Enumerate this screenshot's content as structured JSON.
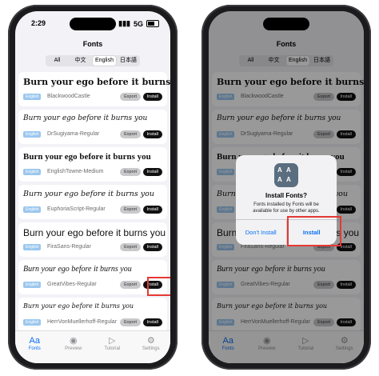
{
  "status": {
    "time": "2:29",
    "signal": "5G",
    "battery": "battery-icon"
  },
  "header": {
    "title": "Fonts"
  },
  "segments": [
    {
      "label": "All",
      "active": false
    },
    {
      "label": "中文",
      "active": false
    },
    {
      "label": "English",
      "active": true
    },
    {
      "label": "日本語",
      "active": false
    }
  ],
  "fonts": [
    {
      "sample": "Burn your ego before it burns you",
      "tag": "English",
      "name": "BlackwoodCastle",
      "export": "Export",
      "install": "Install"
    },
    {
      "sample": "Burn your ego before it burns you",
      "tag": "English",
      "name": "DrSugiyama-Regular",
      "export": "Export",
      "install": "Install"
    },
    {
      "sample": "Burn your ego before it burns you",
      "tag": "English",
      "name": "EnglishTowne-Medium",
      "export": "Export",
      "install": "Install"
    },
    {
      "sample": "Burn your ego before it burns you",
      "tag": "English",
      "name": "EuphoriaScript-Regular",
      "export": "Export",
      "install": "Install"
    },
    {
      "sample": "Burn your ego before it burns you",
      "tag": "English",
      "name": "FiraSans-Regular",
      "export": "Export",
      "install": "Install"
    },
    {
      "sample": "Burn your ego before it burns you",
      "tag": "English",
      "name": "GreatVibes-Regular",
      "export": "Export",
      "install": "Install"
    },
    {
      "sample": "Burn your ego before it burns you",
      "tag": "English",
      "name": "HerrVonMuellerhoff-Regular",
      "export": "Export",
      "install": "Install"
    }
  ],
  "tabs": [
    {
      "label": "Fonts",
      "icon": "font-icon",
      "glyph": "Aa",
      "active": true
    },
    {
      "label": "Preview",
      "icon": "eye-icon",
      "glyph": "◉",
      "active": false
    },
    {
      "label": "Tutorial",
      "icon": "play-icon",
      "glyph": "▷",
      "active": false
    },
    {
      "label": "Settings",
      "icon": "gear-icon",
      "glyph": "⚙",
      "active": false
    }
  ],
  "alert": {
    "title": "Install Fonts?",
    "message": "Fonts installed by Fonts will be available for use by other apps.",
    "cancel": "Don't Install",
    "confirm": "Install",
    "icon": "fonts-app-icon"
  },
  "colors": {
    "accent": "#0a6ff5",
    "highlight": "#e53935",
    "tag": "#9bc7ee"
  }
}
